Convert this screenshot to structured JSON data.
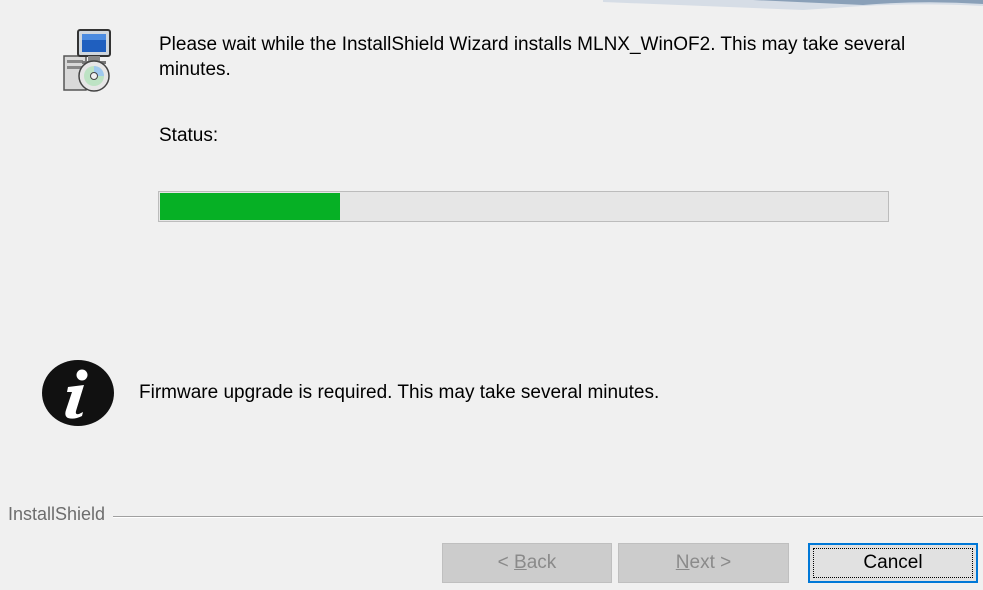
{
  "colors": {
    "window_background": "#f0f0f0",
    "progress_fill": "#06b025",
    "progress_track": "#e6e6e6",
    "focus_border": "#0078d7"
  },
  "header": {
    "icon": "installer-computer-cd-icon",
    "message": "Please wait while the InstallShield Wizard installs MLNX_WinOF2. This may take several minutes."
  },
  "status": {
    "label": "Status:",
    "progress_percent": 25
  },
  "notice": {
    "icon": "info-icon",
    "message": "Firmware upgrade is required. This may take several minutes."
  },
  "branding": {
    "label": "InstallShield"
  },
  "buttons": {
    "back": {
      "mnemonic": "B",
      "rest": "ack",
      "prefix": "< ",
      "enabled": false
    },
    "next": {
      "mnemonic": "N",
      "rest": "ext >",
      "enabled": false
    },
    "cancel": {
      "label": "Cancel",
      "enabled": true,
      "focused": true
    }
  }
}
